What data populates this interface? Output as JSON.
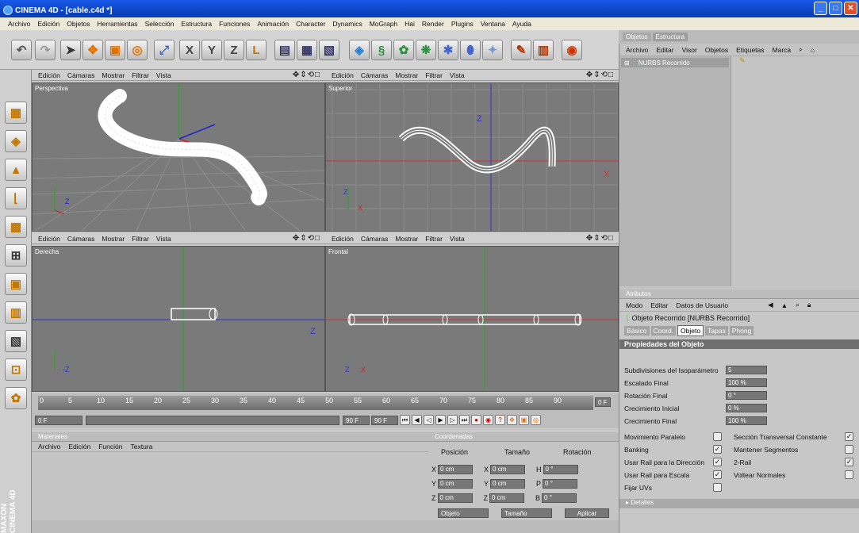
{
  "window": {
    "title": "CINEMA 4D - [cable.c4d *]",
    "min": "_",
    "max": "□",
    "close": "✕"
  },
  "menu": [
    "Archivo",
    "Edición",
    "Objetos",
    "Herramientas",
    "Selección",
    "Estructura",
    "Funciones",
    "Animación",
    "Character",
    "Dynamics",
    "MoGraph",
    "Hai",
    "Render",
    "Plugins",
    "Ventana",
    "Ayuda"
  ],
  "toolbar": {
    "icons": [
      "undo-icon",
      "redo-icon",
      "select-icon",
      "move-icon",
      "scale-icon",
      "rotate-icon",
      "live-select-icon",
      "x-axis-icon",
      "y-axis-icon",
      "z-axis-icon",
      "world-coord-icon",
      "render-view-icon",
      "render-picture-icon",
      "render-settings-icon",
      "cube-icon",
      "spline-icon",
      "nurbs-icon",
      "array-icon",
      "deformer-icon",
      "scene-icon",
      "light-icon",
      "camera-icon",
      "tag-icon",
      "sphere-web-icon"
    ],
    "axis_x": "X",
    "axis_y": "Y",
    "axis_z": "Z"
  },
  "viewport_menu": [
    "Edición",
    "Cámaras",
    "Mostrar",
    "Filtrar",
    "Vista"
  ],
  "viewports": [
    {
      "label": "Perspectiva"
    },
    {
      "label": "Superior"
    },
    {
      "label": "Derecha"
    },
    {
      "label": "Frontal"
    }
  ],
  "timeline": {
    "ticks": [
      "0",
      "5",
      "10",
      "15",
      "20",
      "25",
      "30",
      "35",
      "40",
      "45",
      "50",
      "55",
      "60",
      "65",
      "70",
      "75",
      "80",
      "85",
      "90"
    ],
    "current_frame": "0 F",
    "start_field": "0 F",
    "end_field": "90 F",
    "end_field2": "90 F"
  },
  "materials": {
    "header": "Materiales",
    "menu": [
      "Archivo",
      "Edición",
      "Función",
      "Textura"
    ]
  },
  "coords": {
    "header": "Coordenadas",
    "col_pos": "Posición",
    "col_size": "Tamaño",
    "col_rot": "Rotación",
    "rows": [
      {
        "axis": "X",
        "pos": "0 cm",
        "saxis": "X",
        "size": "0 cm",
        "raxis": "H",
        "rot": "0 °"
      },
      {
        "axis": "Y",
        "pos": "0 cm",
        "saxis": "Y",
        "size": "0 cm",
        "raxis": "P",
        "rot": "0 °"
      },
      {
        "axis": "Z",
        "pos": "0 cm",
        "saxis": "Z",
        "size": "0 cm",
        "raxis": "B",
        "rot": "0 °"
      }
    ],
    "mode": "Objeto",
    "size_mode": "Tamaño",
    "apply": "Aplicar"
  },
  "objects": {
    "tabs": [
      "Objetos",
      "Estructura"
    ],
    "menu": [
      "Archivo",
      "Editar",
      "Visor",
      "Objetos",
      "Etiquetas",
      "Marca"
    ],
    "item": "NURBS Recorrido"
  },
  "attributes": {
    "header": "Atributos",
    "menu": [
      "Modo",
      "Editar",
      "Datos de Usuario"
    ],
    "object_title": "Objeto Recorrido [NURBS Recorrido]",
    "tabs": [
      "Básico",
      "Coord.",
      "Objeto",
      "Tapas",
      "Phong"
    ],
    "active_tab": "Objeto",
    "section": "Propiedades del Objeto",
    "props": [
      {
        "label": "Subdivisiones del Isoparámetro",
        "value": "5"
      },
      {
        "label": "Escalado Final",
        "value": "100 %"
      },
      {
        "label": "Rotación Final",
        "value": "0 °"
      },
      {
        "label": "Crecimiento Inicial",
        "value": "0 %"
      },
      {
        "label": "Crecimiento Final",
        "value": "100 %"
      }
    ],
    "checks_left": [
      {
        "label": "Movimiento Paralelo",
        "checked": false
      },
      {
        "label": "Banking",
        "checked": true
      },
      {
        "label": "Usar Rail para la Dirección",
        "checked": true
      },
      {
        "label": "Usar Rail para Escala",
        "checked": true
      },
      {
        "label": "Fijar UVs",
        "checked": false
      }
    ],
    "checks_right": [
      {
        "label": "Sección Transversal Constante",
        "checked": true
      },
      {
        "label": "Mantener Segmentos",
        "checked": false
      },
      {
        "label": "2-Rail",
        "checked": true
      },
      {
        "label": "Voltear Normales",
        "checked": false
      }
    ],
    "details": "▸ Detalles"
  },
  "branding": "MAXON CINEMA 4D"
}
